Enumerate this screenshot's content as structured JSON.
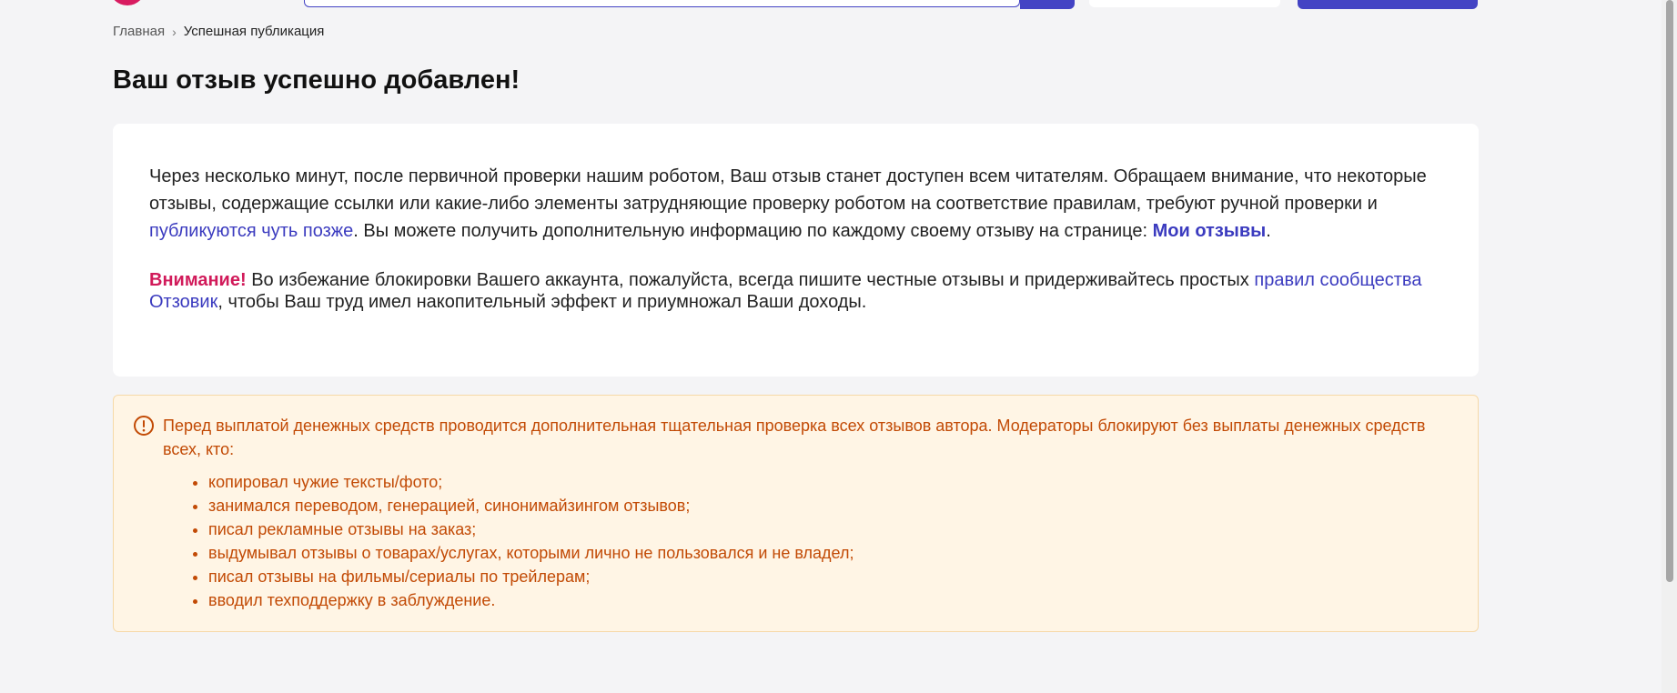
{
  "breadcrumb": {
    "home": "Главная",
    "separator": "›",
    "current": "Успешная публикация"
  },
  "page": {
    "title": "Ваш отзыв успешно добавлен!"
  },
  "card": {
    "p1_text_a": "Через несколько минут, после первичной проверки нашим роботом, Ваш отзыв станет доступен всем читателям. Обращаем внимание, что некоторые отзывы, содержащие ссылки или какие-либо элементы затрудняющие проверку роботом на соответствие правилам, требуют ручной проверки и ",
    "p1_link": "публикуются чуть позже",
    "p1_text_b": ". Вы можете получить дополнительную информацию по каждому своему отзыву на странице: ",
    "p1_link_bold": "Мои отзывы",
    "p1_text_c": ".",
    "attention_label": "Внимание!",
    "p2_text_a": " Во избежание блокировки Вашего аккаунта, пожалуйста, всегда пишите честные отзывы и придерживайтесь простых ",
    "p2_link": "правил сообщества Отзовик",
    "p2_text_b": ", чтобы Ваш труд имел накопительный эффект и приумножал Ваши доходы."
  },
  "notice": {
    "icon": "exclamation-circle-icon",
    "text": "Перед выплатой денежных средств проводится дополнительная тщательная проверка всех отзывов автора. Модераторы блокируют без выплаты денежных средств всех, кто:",
    "items": [
      "копировал чужие тексты/фото;",
      "занимался переводом, генерацией, синонимайзингом отзывов;",
      "писал рекламные отзывы на заказ;",
      "выдумывал отзывы о товарах/услугах, которыми лично не пользовался и не владел;",
      "писал отзывы на фильмы/сериалы по трейлерам;",
      "вводил техподдержку в заблуждение."
    ]
  },
  "colors": {
    "accent": "#3b3bbf",
    "attention": "#d11a5a",
    "notice_text": "#c24a05",
    "notice_bg": "#fff5e5",
    "page_bg": "#f4f4f6"
  }
}
